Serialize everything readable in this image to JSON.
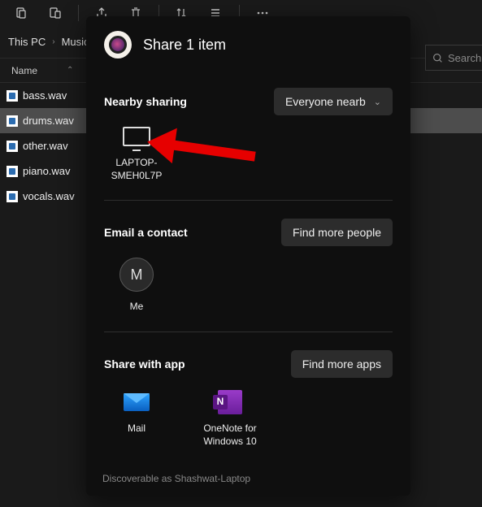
{
  "toolbar": {
    "icons": [
      "copy",
      "paste",
      "share",
      "delete",
      "sort",
      "view",
      "more"
    ]
  },
  "breadcrumbs": [
    "This PC",
    "Music"
  ],
  "search": {
    "placeholder": "Search"
  },
  "list": {
    "header": "Name",
    "files": [
      {
        "name": "bass.wav",
        "selected": false
      },
      {
        "name": "drums.wav",
        "selected": true
      },
      {
        "name": "other.wav",
        "selected": false
      },
      {
        "name": "piano.wav",
        "selected": false
      },
      {
        "name": "vocals.wav",
        "selected": false
      }
    ]
  },
  "share": {
    "title": "Share 1 item",
    "nearby": {
      "label": "Nearby sharing",
      "dropdown": "Everyone nearb",
      "targets": [
        {
          "name": "LAPTOP-SMEH0L7P",
          "icon": "monitor"
        }
      ]
    },
    "email": {
      "label": "Email a contact",
      "button": "Find more people",
      "contacts": [
        {
          "initial": "M",
          "name": "Me"
        }
      ]
    },
    "apps": {
      "label": "Share with app",
      "button": "Find more apps",
      "items": [
        {
          "name": "Mail",
          "icon": "mail"
        },
        {
          "name": "OneNote for Windows 10",
          "icon": "onenote"
        }
      ]
    },
    "footer": "Discoverable as Shashwat-Laptop"
  }
}
